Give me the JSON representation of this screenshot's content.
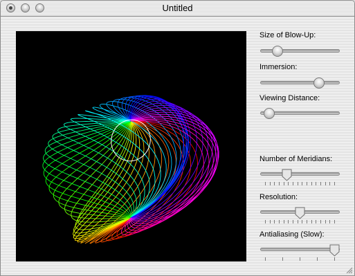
{
  "window": {
    "title": "Untitled"
  },
  "controls": {
    "size_of_blowup": {
      "label": "Size of Blow-Up:",
      "value": 0.17
    },
    "immersion": {
      "label": "Immersion:",
      "value": 0.78
    },
    "viewing_distance": {
      "label": "Viewing Distance:",
      "value": 0.05
    },
    "number_of_meridians": {
      "label": "Number of Meridians:",
      "value": 0.31,
      "ticks": 16
    },
    "resolution": {
      "label": "Resolution:",
      "value": 0.5,
      "ticks": 16
    },
    "antialiasing": {
      "label": "Antialiasing (Slow):",
      "value": 1.0,
      "ticks": 5
    }
  }
}
